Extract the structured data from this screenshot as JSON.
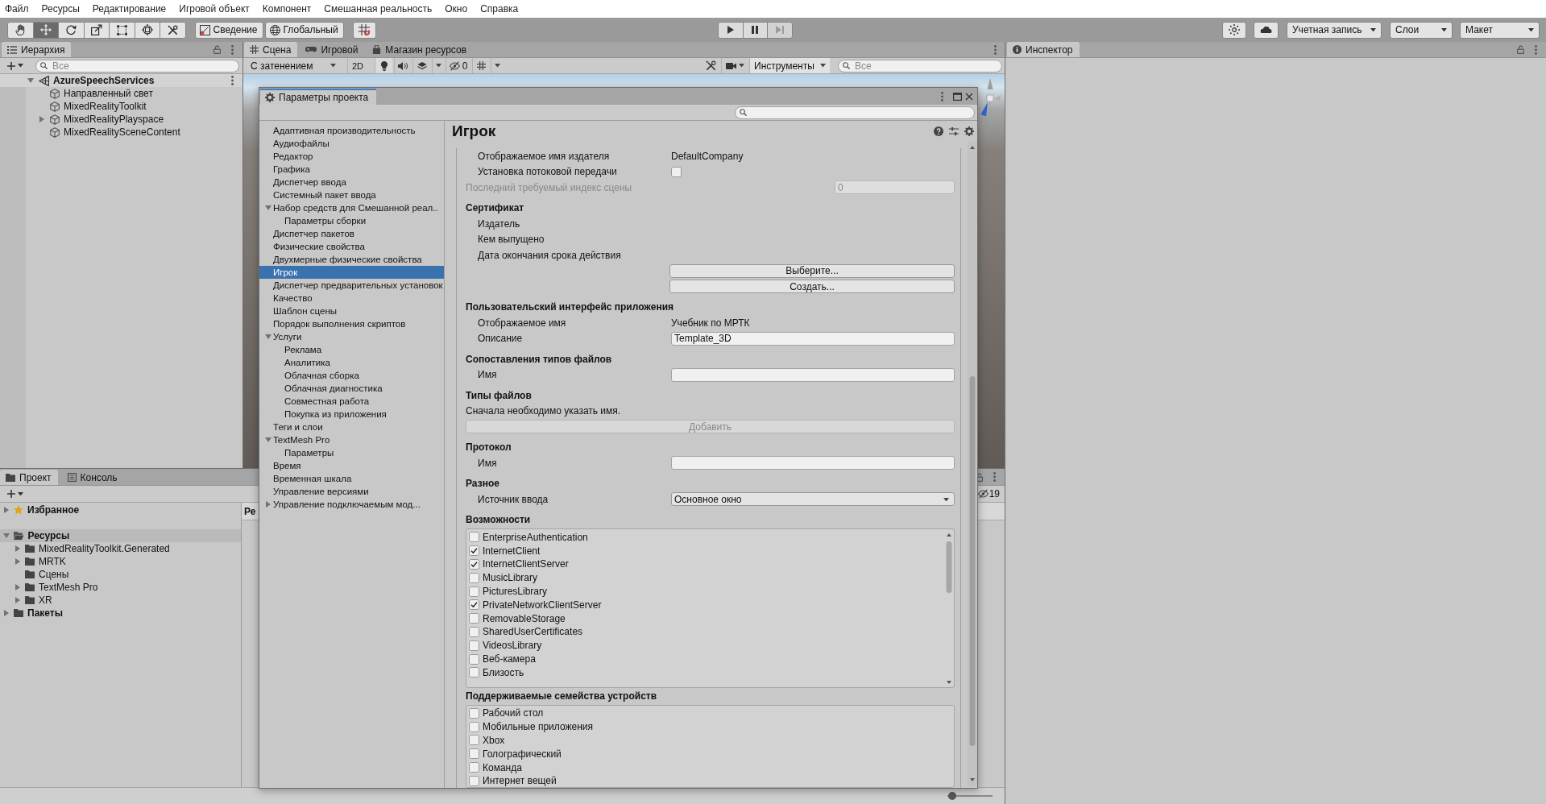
{
  "menu_bar": {
    "items": [
      "Файл",
      "Ресурсы",
      "Редактирование",
      "Игровой объект",
      "Компонент",
      "Смешанная реальность",
      "Окно",
      "Справка"
    ]
  },
  "toolbar": {
    "tools": [
      {
        "kind": "hand",
        "selected": false
      },
      {
        "kind": "move",
        "selected": true
      },
      {
        "kind": "rotate",
        "selected": false
      },
      {
        "kind": "scale",
        "selected": false
      },
      {
        "kind": "rect",
        "selected": false
      },
      {
        "kind": "transform",
        "selected": false
      },
      {
        "kind": "custom",
        "selected": false
      }
    ],
    "handle_buttons": [
      {
        "kind": "pivot",
        "label": "Сведение"
      },
      {
        "kind": "space",
        "label": "Глобальный"
      }
    ],
    "play_controls": [
      {
        "kind": "play",
        "disabled": false
      },
      {
        "kind": "pause",
        "disabled": false
      },
      {
        "kind": "step",
        "disabled": true
      }
    ],
    "dropdowns": [
      "Учетная запись",
      "Слои",
      "Макет"
    ]
  },
  "hierarchy": {
    "tab": "Иерархия",
    "search": {
      "placeholder": "Все"
    },
    "scene": {
      "name": "AzureSpeechServices",
      "expanded": true,
      "children": [
        {
          "name": "Направленный свет"
        },
        {
          "name": "MixedRealityToolkit"
        },
        {
          "name": "MixedRealityPlayspace",
          "expanded": false
        },
        {
          "name": "MixedRealitySceneContent"
        }
      ]
    }
  },
  "scene": {
    "tabs": [
      {
        "kind": "scene",
        "label": "Сцена",
        "selected": true
      },
      {
        "kind": "game",
        "label": "Игровой",
        "selected": false
      },
      {
        "kind": "store",
        "label": "Магазин ресурсов",
        "selected": false
      }
    ],
    "shading_dropdown": "С затенением",
    "view_mode_button": "2D",
    "hidden_count": "0",
    "tools_dropdown": "Инструменты",
    "search": {
      "placeholder": "Все"
    }
  },
  "inspector": {
    "tab": "Инспектор"
  },
  "project": {
    "tabs": [
      {
        "kind": "project",
        "label": "Проект",
        "selected": true
      },
      {
        "kind": "console",
        "label": "Консоль",
        "selected": false
      }
    ],
    "hidden_count": "19",
    "tree": [
      {
        "kind": "favorites",
        "label": "Избранное",
        "expanded": false,
        "selected": false
      },
      {
        "kind": "folder",
        "label": "Ресурсы",
        "expanded": true,
        "selected": true,
        "children": [
          {
            "kind": "folder",
            "label": "MixedRealityToolkit.Generated",
            "expanded": false,
            "selected": false
          },
          {
            "kind": "folder",
            "label": "MRTK",
            "expanded": false,
            "selected": false
          },
          {
            "kind": "folder",
            "label": "Сцены",
            "selected": false
          },
          {
            "kind": "folder",
            "label": "TextMesh Pro",
            "expanded": false,
            "selected": false
          },
          {
            "kind": "folder",
            "label": "XR",
            "expanded": false,
            "selected": false
          }
        ]
      },
      {
        "kind": "folder",
        "label": "Пакеты",
        "expanded": false,
        "selected": false
      }
    ],
    "breadcrumb": "Ре",
    "icon_size_slider": {
      "level": 0.02
    }
  },
  "project_settings": {
    "title": "Параметры проекта",
    "categories": [
      {
        "label": "Адаптивная производительность",
        "selected": false
      },
      {
        "label": "Аудиофайлы",
        "selected": false
      },
      {
        "label": "Редактор",
        "selected": false
      },
      {
        "label": "Графика",
        "selected": false
      },
      {
        "label": "Диспетчер ввода",
        "selected": false
      },
      {
        "label": "Системный пакет ввода",
        "selected": false
      },
      {
        "label": "Набор средств для Смешанной реал..",
        "expanded": true,
        "selected": false,
        "children": [
          {
            "label": "Параметры сборки",
            "selected": false
          }
        ]
      },
      {
        "label": "Диспетчер пакетов",
        "selected": false
      },
      {
        "label": "Физические свойства",
        "selected": false
      },
      {
        "label": "Двухмерные физические свойства",
        "selected": false
      },
      {
        "label": "Игрок",
        "selected": true
      },
      {
        "label": "Диспетчер предварительных установок",
        "selected": false
      },
      {
        "label": "Качество",
        "selected": false
      },
      {
        "label": "Шаблон сцены",
        "selected": false
      },
      {
        "label": "Порядок выполнения скриптов",
        "selected": false
      },
      {
        "label": "Услуги",
        "expanded": true,
        "selected": false,
        "children": [
          {
            "label": "Реклама",
            "selected": false
          },
          {
            "label": "Аналитика",
            "selected": false
          },
          {
            "label": "Облачная сборка",
            "selected": false
          },
          {
            "label": "Облачная диагностика",
            "selected": false
          },
          {
            "label": "Совместная работа",
            "selected": false
          },
          {
            "label": "Покупка из приложения",
            "selected": false
          }
        ]
      },
      {
        "label": "Теги и слои",
        "selected": false
      },
      {
        "label": "TextMesh Pro",
        "expanded": true,
        "selected": false,
        "children": [
          {
            "label": "Параметры",
            "selected": false
          }
        ]
      },
      {
        "label": "Время",
        "selected": false
      },
      {
        "label": "Временная шкала",
        "selected": false
      },
      {
        "label": "Управление версиями",
        "selected": false
      },
      {
        "label": "Управление подключаемым мод...",
        "expanded": false,
        "selected": false
      }
    ],
    "panel": {
      "title": "Игрок",
      "items": [
        {
          "kind": "group",
          "children": [
            {
              "kind": "text",
              "label": "Отображаемое имя издателя",
              "value": "DefaultCompany"
            },
            {
              "kind": "checkbox",
              "label": "Установка потоковой передачи",
              "checked": false
            }
          ]
        },
        {
          "kind": "number",
          "label": "Последний требуемый индекс сцены",
          "value": "0",
          "disabled": true
        },
        {
          "kind": "group",
          "label": "Сертификат",
          "children": [
            {
              "kind": "label",
              "label": "Издатель"
            },
            {
              "kind": "label",
              "label": "Кем выпущено"
            },
            {
              "kind": "label",
              "label": "Дата окончания срока действия"
            },
            {
              "kind": "button",
              "label": "Выберите...",
              "disabled": false
            },
            {
              "kind": "button",
              "label": "Создать...",
              "disabled": false
            }
          ]
        },
        {
          "kind": "group",
          "label": "Пользовательский интерфейс приложения",
          "children": [
            {
              "kind": "text",
              "label": "Отображаемое имя",
              "value": "Учебник по МРТК"
            },
            {
              "kind": "field",
              "label": "Описание",
              "value": "Template_3D"
            }
          ]
        },
        {
          "kind": "group",
          "label": "Сопоставления типов файлов",
          "children": [
            {
              "kind": "field",
              "label": "Имя"
            }
          ]
        },
        {
          "kind": "group",
          "label": "Типы файлов",
          "children": [
            {
              "kind": "note",
              "label": "Сначала необходимо указать имя."
            },
            {
              "kind": "wide_button",
              "label": "Добавить",
              "disabled": true
            }
          ]
        },
        {
          "kind": "group",
          "label": "Протокол",
          "children": [
            {
              "kind": "field",
              "label": "Имя"
            }
          ]
        },
        {
          "kind": "group",
          "label": "Разное",
          "children": [
            {
              "kind": "dropdown",
              "label": "Источник ввода",
              "value": "Основное окно"
            }
          ]
        },
        {
          "kind": "group",
          "label": "Возможности",
          "children": [
            {
              "kind": "checklist",
              "scrollbar": true,
              "items": [
                {
                  "label": "EnterpriseAuthentication",
                  "checked": false
                },
                {
                  "label": "InternetClient",
                  "checked": true
                },
                {
                  "label": "InternetClientServer",
                  "checked": true
                },
                {
                  "label": "MusicLibrary",
                  "checked": false
                },
                {
                  "label": "PicturesLibrary",
                  "checked": false
                },
                {
                  "label": "PrivateNetworkClientServer",
                  "checked": true
                },
                {
                  "label": "RemovableStorage",
                  "checked": false
                },
                {
                  "label": "SharedUserCertificates",
                  "checked": false
                },
                {
                  "label": "VideosLibrary",
                  "checked": false
                },
                {
                  "label": "Веб-камера",
                  "checked": false
                },
                {
                  "label": "Близость",
                  "checked": false
                }
              ]
            }
          ]
        },
        {
          "kind": "group",
          "label": "Поддерживаемые семейства устройств",
          "children": [
            {
              "kind": "checklist",
              "scrollbar": false,
              "items": [
                {
                  "label": "Рабочий стол",
                  "checked": false
                },
                {
                  "label": "Мобильные приложения",
                  "checked": false
                },
                {
                  "label": "Xbox",
                  "checked": false
                },
                {
                  "label": "Голографический",
                  "checked": false
                },
                {
                  "label": "Команда",
                  "checked": false
                },
                {
                  "label": "Интернет вещей",
                  "checked": false
                }
              ]
            }
          ]
        }
      ]
    }
  }
}
